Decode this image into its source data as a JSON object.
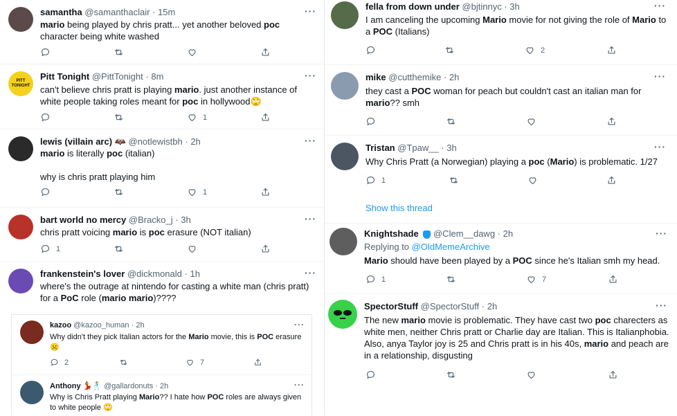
{
  "left_column": [
    {
      "name": "samantha",
      "handle": "@samanthaclair",
      "time": "15m",
      "text_html": "<b>mario</b> being played by chris pratt... yet another beloved <b>poc</b> character being white washed",
      "reply_count": "",
      "like_count": ""
    },
    {
      "name": "Pitt Tonight",
      "handle": "@PittTonight",
      "time": "8m",
      "avatar_text": "PITT TONIGHT",
      "text_html": "can't believe chris pratt is playing <b>mario</b>.  just another instance of white people taking roles meant for <b>poc</b> in hollywood🙄",
      "reply_count": "",
      "like_count": "1"
    },
    {
      "name": "lewis (villain arc) 🦇",
      "handle": "@notlewistbh",
      "time": "2h",
      "text_html": "<b>mario</b> is literally <b>poc</b> (italian)<br><br>why is chris pratt playing him",
      "reply_count": "",
      "like_count": "1"
    },
    {
      "name": "bart world no mercy",
      "handle": "@Bracko_j",
      "time": "3h",
      "text_html": "chris pratt voicing <b>mario</b> is <b>poc</b> erasure (NOT italian)",
      "reply_count": "1",
      "like_count": ""
    },
    {
      "name": "frankenstein's lover",
      "handle": "@dickmonald",
      "time": "1h",
      "text_html": "where's the outrage at nintendo for casting a white man (chris pratt) for a <b>PoC</b> role (<b>mario mario</b>)????"
    }
  ],
  "overlay": [
    {
      "name": "kazoo",
      "handle": "@kazoo_human",
      "time": "2h",
      "text_html": "Why didn't they pick Italian actors for the <b>Mario</b> movie, this is <b>POC</b> erasure<br>☹️",
      "reply_count": "2",
      "like_count": "7"
    },
    {
      "name": "Anthony 💃🕺",
      "handle": "@gallardonuts",
      "time": "2h",
      "text_html": "Why is Chris Pratt playing <b>Mario</b>?? I hate how <b>POC</b> roles are always given to white people 🙄"
    }
  ],
  "right_column": [
    {
      "name": "fella from down under",
      "handle": "@bjtinnyc",
      "time": "3h",
      "text_html": "I am canceling the upcoming <b>Mario</b> movie for not giving the role of <b>Mario</b> to a <b>POC</b> (Italians)",
      "reply_count": "",
      "like_count": "2"
    },
    {
      "name": "mike",
      "handle": "@cutthemike",
      "time": "2h",
      "text_html": "they cast a <b>POC</b> woman for peach but couldn't cast an italian man for <b>mario</b>?? smh",
      "reply_count": "",
      "like_count": ""
    },
    {
      "name": "Tristan",
      "handle": "@Tpaw__",
      "time": "3h",
      "text_html": "Why Chris Pratt (a Norwegian) playing a <b>poc</b> (<b>Mario</b>) is problematic. 1/27",
      "reply_count": "1",
      "like_count": "",
      "show_thread": "Show this thread"
    },
    {
      "name": "Knightshade",
      "handle": "@Clem__dawg",
      "time": "2h",
      "replying_label": "Replying to",
      "replying_to": "@OldMemeArchive",
      "text_html": "<b>Mario</b> should have been played by a <b>POC</b> since he's Italian smh my head.",
      "reply_count": "1",
      "like_count": "7"
    },
    {
      "name": "SpectorStuff",
      "handle": "@SpectorStuff",
      "time": "2h",
      "text_html": "The new <b>mario</b> movie is problematic. They have cast two <b>poc</b> charecters as white men, neither Chris pratt or Charlie day are Italian. This is Italianphobia. Also, anya Taylor joy is 25 and Chris pratt is in his 40s, <b>mario</b> and peach are in a relationship, disgusting",
      "reply_count": "",
      "like_count": ""
    }
  ],
  "ui": {
    "more_glyph": "···",
    "dot": "·"
  },
  "icons": [
    "reply-icon",
    "retweet-icon",
    "like-icon",
    "share-icon",
    "more-icon",
    "verified-badge-icon"
  ],
  "colors": {
    "link": "#1d9bf0",
    "text": "#0f1419",
    "muted": "#536471",
    "border": "#eff3f4"
  }
}
